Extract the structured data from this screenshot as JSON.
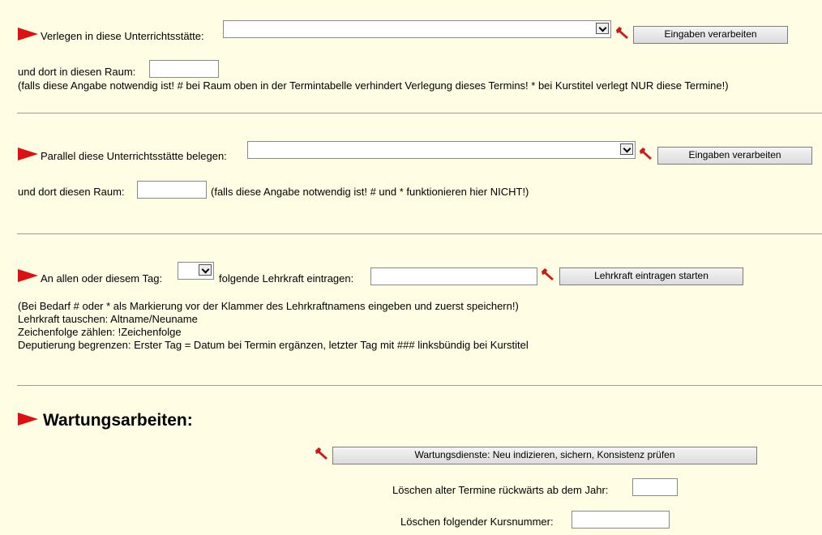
{
  "section1": {
    "label": "Verlegen in diese Unterrichtsstätte:",
    "select_value": "",
    "button": "Eingaben verarbeiten",
    "room_label": "und dort in diesen Raum:",
    "room_value": "",
    "note": "(falls diese Angabe notwendig ist! # bei Raum oben in der Termintabelle verhindert Verlegung dieses Termins! * bei Kurstitel verlegt NUR diese Termine!)"
  },
  "section2": {
    "label": "Parallel diese Unterrichtsstätte belegen:",
    "select_value": "",
    "button": "Eingaben verarbeiten",
    "room_label": "und dort diesen Raum:",
    "room_value": "",
    "note": "(falls diese Angabe notwendig ist! # und * funktionieren hier NICHT!)"
  },
  "section3": {
    "label": "An allen oder diesem Tag:",
    "day_value": "",
    "teacher_label": "folgende Lehrkraft eintragen:",
    "teacher_value": "",
    "button": "Lehrkraft eintragen starten",
    "notes": [
      "(Bei Bedarf # oder * als Markierung vor der Klammer des Lehrkraftnamens eingeben und zuerst speichern!)",
      "Lehrkraft tauschen: Altname/Neuname",
      "Zeichenfolge zählen: !Zeichenfolge",
      "Deputierung begrenzen: Erster Tag = Datum bei Termin ergänzen, letzter Tag mit ### linksbündig bei Kurstitel"
    ]
  },
  "maintenance": {
    "heading": "Wartungsarbeiten:",
    "button": "Wartungsdienste: Neu indizieren, sichern, Konsistenz prüfen",
    "delete_year_label": "Löschen alter Termine rückwärts ab dem Jahr:",
    "delete_year_value": "",
    "delete_course_label": "Löschen folgender Kursnummer:",
    "delete_course_value": ""
  },
  "colors": {
    "background": "#fffde3",
    "flag": "#dd1111",
    "wrench": "#cc1a1a"
  },
  "icons": {
    "flag": "red-flag-icon",
    "wrench": "wrench-icon"
  }
}
